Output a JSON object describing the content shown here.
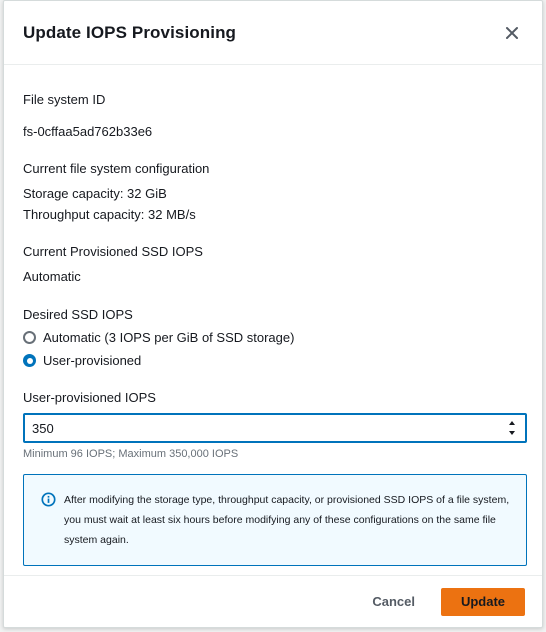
{
  "modal": {
    "title": "Update IOPS Provisioning"
  },
  "file_system": {
    "id_label": "File system ID",
    "id_value": "fs-0cffaa5ad762b33e6"
  },
  "current_config": {
    "label": "Current file system configuration",
    "storage": "Storage capacity: 32 GiB",
    "throughput": "Throughput capacity: 32 MB/s"
  },
  "current_iops": {
    "label": "Current Provisioned SSD IOPS",
    "value": "Automatic"
  },
  "desired_iops": {
    "label": "Desired SSD IOPS",
    "options": [
      {
        "label": "Automatic (3 IOPS per GiB of SSD storage)",
        "selected": false
      },
      {
        "label": "User-provisioned",
        "selected": true
      }
    ]
  },
  "user_iops": {
    "label": "User-provisioned IOPS",
    "value": "350",
    "hint": "Minimum 96 IOPS; Maximum 350,000 IOPS"
  },
  "info": {
    "icon": "info-icon",
    "text": "After modifying the storage type, throughput capacity, or provisioned SSD IOPS of a file system, you must wait at least six hours before modifying any of these configurations on the same file system again."
  },
  "footer": {
    "cancel_label": "Cancel",
    "update_label": "Update"
  },
  "colors": {
    "primary": "#ec7211",
    "link_blue": "#0073bb",
    "info_bg": "#f1faff"
  }
}
